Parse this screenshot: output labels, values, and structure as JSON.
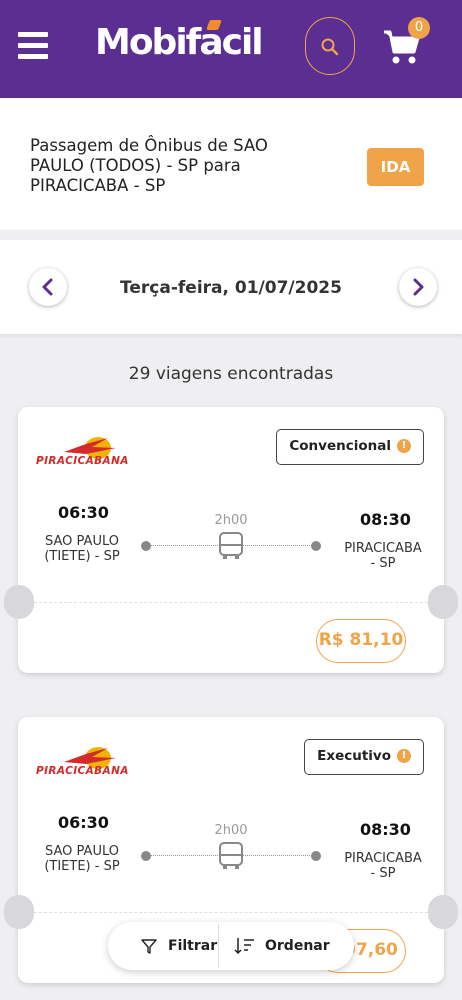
{
  "header": {
    "logo_text": "Mobifacil",
    "cart_count": "0",
    "brand_color": "#5b2e91",
    "accent_color": "#f0a44a",
    "icons": [
      "menu-icon",
      "search-icon",
      "cart-icon"
    ]
  },
  "route": {
    "title": "Passagem de Ônibus de SAO PAULO (TODOS) - SP para PIRACICABA - SP",
    "direction_badge": "IDA"
  },
  "date_nav": {
    "date": "Terça-feira, 01/07/2025",
    "icons": [
      "chevron-left-icon",
      "chevron-right-icon"
    ]
  },
  "results": {
    "count_text": "29 viagens encontradas"
  },
  "trips": [
    {
      "company": "PIRACICABANA",
      "class": "Convencional",
      "departure_time": "06:30",
      "departure_city": "SAO PAULO (TIETE) - SP",
      "duration": "2h00",
      "arrival_time": "08:30",
      "arrival_city": "PIRACICABA - SP",
      "price": "R$ 81,10"
    },
    {
      "company": "PIRACICABANA",
      "class": "Executivo",
      "departure_time": "06:30",
      "departure_city": "SAO PAULO (TIETE) - SP",
      "duration": "2h00",
      "arrival_time": "08:30",
      "arrival_city": "PIRACICABA - SP",
      "price": "97,60"
    }
  ],
  "bottom_bar": {
    "filter_label": "Filtrar",
    "sort_label": "Ordenar"
  }
}
